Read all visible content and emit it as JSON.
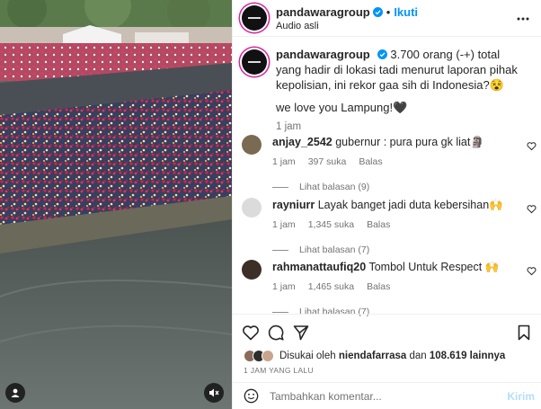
{
  "post": {
    "username": "pandawaragroup",
    "follow_label": "Ikuti",
    "separator": "•",
    "audio_label": "Audio asli",
    "caption": "3.700 orang (-+) total yang hadir di lokasi tadi menurut laporan pihak kepolisian, ini rekor gaa sih di Indonesia?😵",
    "caption_second": "we love you Lampung!🖤",
    "time": "1 jam"
  },
  "comments": [
    {
      "username": "anjay_2542",
      "text": "gubernur : pura pura gk liat🗿",
      "time": "1 jam",
      "likes": "397 suka",
      "reply_label": "Balas",
      "view_replies": "Lihat balasan (9)",
      "avatar_color": "#7a6a52"
    },
    {
      "username": "rayniurr",
      "text": "Layak banget jadi duta kebersihan🙌",
      "time": "1 jam",
      "likes": "1,345 suka",
      "reply_label": "Balas",
      "view_replies": "Lihat balasan (7)",
      "avatar_color": "#dbdbdb"
    },
    {
      "username": "rahmanattaufiq20",
      "text": "Tombol Untuk Respect 🙌",
      "time": "1 jam",
      "likes": "1,465 suka",
      "reply_label": "Balas",
      "view_replies": "Lihat balasan (7)",
      "avatar_color": "#3b2f27"
    }
  ],
  "likes": {
    "prefix": "Disukai oleh",
    "user": "niendafarrasa",
    "connector": "dan",
    "count": "108.619 lainnya"
  },
  "date": "1 JAM YANG LALU",
  "composer": {
    "placeholder": "Tambahkan komentar...",
    "send_label": "Kirim"
  },
  "icons": {
    "more": "more-horizontal-icon",
    "like": "heart-icon",
    "comment": "comment-icon",
    "share": "send-icon",
    "save": "bookmark-icon",
    "emoji": "emoji-icon",
    "user_tag": "user-tag-icon",
    "mute": "mute-icon",
    "verified": "verified-badge-icon"
  },
  "colors": {
    "accent": "#0095f6",
    "verified": "#0095f6",
    "send_disabled": "#b2dffc"
  }
}
